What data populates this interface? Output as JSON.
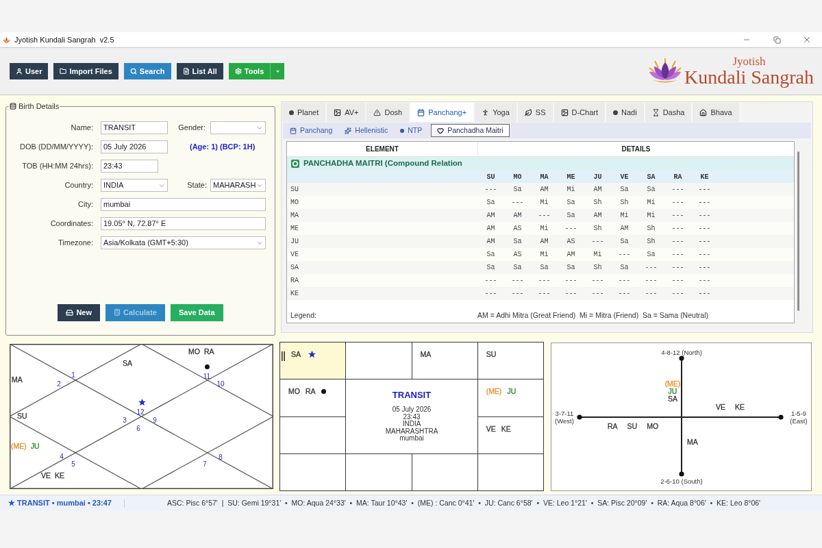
{
  "window": {
    "title": "Jyotish Kundali Sangrah  v2.5"
  },
  "toolbar": {
    "buttons": [
      {
        "label": "User",
        "kind": "dark"
      },
      {
        "label": "Import Files",
        "kind": "dark"
      },
      {
        "label": "Search",
        "kind": "blue"
      },
      {
        "label": "List All",
        "kind": "dark"
      },
      {
        "label": "Tools",
        "kind": "split"
      }
    ]
  },
  "logo": {
    "title": "Jyotish",
    "subtitle": "Kundali Sangrah"
  },
  "birth_details": {
    "title": "Birth Details",
    "name": {
      "label": "Name:",
      "value": "TRANSIT"
    },
    "gender": {
      "label": "Gender:"
    },
    "dob": {
      "label": "DOB (DD/MM/YYYY):",
      "value": "05 July 2026"
    },
    "age_note": "(Age: 1) (BCP: 1H)",
    "tob": {
      "label": "TOB (HH:MM 24hrs):",
      "value": "23:43"
    },
    "country": {
      "label": "Country:",
      "value": "INDIA"
    },
    "state": {
      "label": "State:",
      "value": "MAHARASH"
    },
    "city": {
      "label": "City:",
      "value": "mumbai"
    },
    "coordinates": {
      "label": "Coordinates:",
      "value": "19.05° N, 72.87° E"
    },
    "timezone": {
      "label": "Timezone:",
      "value": "Asia/Kolkata (GMT+5:30)"
    },
    "buttons": [
      {
        "label": "New",
        "kind": "dark",
        "disabled": false
      },
      {
        "label": "Calculate",
        "kind": "blue",
        "disabled": true
      },
      {
        "label": "Save Data",
        "kind": "green",
        "disabled": false
      }
    ]
  },
  "tabs": [
    {
      "label": "Planet",
      "selected": false
    },
    {
      "label": "AV+",
      "selected": false
    },
    {
      "label": "Dosh",
      "selected": false
    },
    {
      "label": "Panchang+",
      "selected": true
    },
    {
      "label": "Yoga",
      "selected": false
    },
    {
      "label": "SS",
      "selected": false
    },
    {
      "label": "D-Chart",
      "selected": false
    },
    {
      "label": "Nadi",
      "selected": false
    },
    {
      "label": "Dasha",
      "selected": false
    },
    {
      "label": "Bhava",
      "selected": false
    }
  ],
  "sub_tabs": [
    {
      "label": "Panchang",
      "selected": false
    },
    {
      "label": "Hellenistic",
      "selected": false
    },
    {
      "label": "NTP",
      "selected": false
    },
    {
      "label": "Panchadha Maitri",
      "selected": true
    }
  ],
  "maitri_table": {
    "headers": {
      "element": "ELEMENT",
      "details": "DETAILS"
    },
    "section": "PANCHADHA MAITRI (Compound Relation",
    "planet_columns": [
      "SU",
      "MO",
      "MA",
      "ME",
      "JU",
      "VE",
      "SA",
      "RA",
      "KE"
    ],
    "rows": [
      {
        "label": "SU",
        "cells": [
          "---",
          "Sa",
          "AM",
          "Mi",
          "AM",
          "Sa",
          "Sa",
          "---",
          "---"
        ]
      },
      {
        "label": "MO",
        "cells": [
          "Sa",
          "---",
          "Mi",
          "Sa",
          "Sh",
          "Sh",
          "Mi",
          "---",
          "---"
        ]
      },
      {
        "label": "MA",
        "cells": [
          "AM",
          "AM",
          "---",
          "Sa",
          "AM",
          "Mi",
          "Mi",
          "---",
          "---"
        ]
      },
      {
        "label": "ME",
        "cells": [
          "AM",
          "AS",
          "Mi",
          "---",
          "Sh",
          "AM",
          "Sh",
          "---",
          "---"
        ]
      },
      {
        "label": "JU",
        "cells": [
          "AM",
          "Sa",
          "AM",
          "AS",
          "---",
          "Sa",
          "Sh",
          "---",
          "---"
        ]
      },
      {
        "label": "VE",
        "cells": [
          "Sa",
          "AS",
          "Mi",
          "AM",
          "Mi",
          "---",
          "Sa",
          "---",
          "---"
        ]
      },
      {
        "label": "SA",
        "cells": [
          "Sa",
          "Sa",
          "Sa",
          "Sa",
          "Sh",
          "Sa",
          "---",
          "---",
          "---"
        ]
      },
      {
        "label": "RA",
        "cells": [
          "---",
          "---",
          "---",
          "---",
          "---",
          "---",
          "---",
          "---",
          "---"
        ]
      },
      {
        "label": "KE",
        "cells": [
          "---",
          "---",
          "---",
          "---",
          "---",
          "---",
          "---",
          "---",
          "---"
        ]
      }
    ],
    "legend_label": "Legend:",
    "legend": "AM = Adhi Mitra (Great Friend)  Mi = Mitra (Friend)  Sa = Sama (Neutral)"
  },
  "north_chart": {
    "houses": [
      {
        "sign": "12",
        "planets": [
          {
            "name": "SA",
            "color": "#3a3a3a"
          }
        ],
        "star_mark": true,
        "dot_mark": false
      },
      {
        "sign": "1",
        "star_mark": false,
        "dot_mark": false
      },
      {
        "sign": "2",
        "planets": [
          {
            "name": "MA",
            "color": "#3a3a3a"
          }
        ],
        "star_mark": false,
        "dot_mark": false
      },
      {
        "sign": "3",
        "planets": [
          {
            "name": "SU",
            "color": "#3a3a3a"
          }
        ],
        "star_mark": false,
        "dot_mark": false
      },
      {
        "sign": "4",
        "planets": [
          {
            "name": "(ME)",
            "color": "#e8912d"
          },
          {
            "name": "JU",
            "color": "#2e8b2e"
          }
        ],
        "star_mark": false,
        "dot_mark": false
      },
      {
        "sign": "5",
        "planets": [
          {
            "name": "VE",
            "color": "#3a3a3a"
          },
          {
            "name": "KE",
            "color": "#3a3a3a"
          }
        ],
        "star_mark": false,
        "dot_mark": false
      },
      {
        "sign": "6",
        "star_mark": false,
        "dot_mark": false
      },
      {
        "sign": "7",
        "star_mark": false,
        "dot_mark": false
      },
      {
        "sign": "8",
        "star_mark": false,
        "dot_mark": false
      },
      {
        "sign": "9",
        "star_mark": false,
        "dot_mark": false
      },
      {
        "sign": "10",
        "star_mark": false,
        "dot_mark": false
      },
      {
        "sign": "11",
        "planets": [
          {
            "name": "MO",
            "color": "#3a3a3a"
          },
          {
            "name": "RA",
            "color": "#3a3a3a"
          }
        ],
        "star_mark": false,
        "dot_mark": true
      }
    ]
  },
  "south_chart": {
    "cells": [
      {
        "highlighted": true,
        "planets": [
          {
            "name": "SA",
            "color": "#3a3a3a"
          }
        ],
        "star_mark": true,
        "dot_mark": false
      },
      {
        "highlighted": false,
        "star_mark": false,
        "dot_mark": false
      },
      {
        "highlighted": false,
        "planets": [
          {
            "name": "MA",
            "color": "#3a3a3a"
          }
        ],
        "star_mark": false,
        "dot_mark": false
      },
      {
        "highlighted": false,
        "planets": [
          {
            "name": "SU",
            "color": "#3a3a3a"
          }
        ],
        "star_mark": false,
        "dot_mark": false
      },
      {
        "highlighted": false,
        "planets": [
          {
            "name": "MO",
            "color": "#3a3a3a"
          },
          {
            "name": "RA",
            "color": "#3a3a3a"
          }
        ],
        "star_mark": false,
        "dot_mark": true
      },
      {
        "highlighted": false,
        "planets": [
          {
            "name": "(ME)",
            "color": "#e8912d"
          },
          {
            "name": "JU",
            "color": "#2e8b2e"
          }
        ],
        "star_mark": false,
        "dot_mark": false
      },
      {
        "highlighted": false,
        "star_mark": false,
        "dot_mark": false
      },
      {
        "highlighted": false,
        "planets": [
          {
            "name": "VE",
            "color": "#3a3a3a"
          },
          {
            "name": "KE",
            "color": "#3a3a3a"
          }
        ],
        "star_mark": false,
        "dot_mark": false
      },
      {
        "highlighted": false,
        "star_mark": false,
        "dot_mark": false
      },
      {
        "highlighted": false,
        "star_mark": false,
        "dot_mark": false
      },
      {
        "highlighted": false,
        "star_mark": false,
        "dot_mark": false
      },
      {
        "highlighted": false,
        "star_mark": false,
        "dot_mark": false
      }
    ],
    "center": {
      "title": "TRANSIT",
      "lines": [
        "05 July 2026",
        "23:43",
        "INDIA",
        "MAHARASHTRA",
        "mumbai"
      ]
    }
  },
  "cross_chart": {
    "quadrants": [
      {
        "kind": "north",
        "label": "4-8-12 (North)",
        "planets": [
          {
            "name": "(ME)",
            "color": "#e8912d"
          },
          {
            "name": "JU",
            "color": "#2e8b2e"
          },
          {
            "name": "SA",
            "color": "#3a3a3a"
          }
        ]
      },
      {
        "kind": "west",
        "label": "3-7-11 (West)",
        "planets": [
          {
            "name": "RA",
            "color": "#3a3a3a"
          },
          {
            "name": "SU",
            "color": "#3a3a3a"
          },
          {
            "name": "MO",
            "color": "#3a3a3a"
          }
        ]
      },
      {
        "kind": "east",
        "label": "1-5-9 (East)",
        "planets": [
          {
            "name": "VE",
            "color": "#3a3a3a"
          },
          {
            "name": "KE",
            "color": "#3a3a3a"
          }
        ]
      },
      {
        "kind": "south",
        "label": "2-6-10 (South)",
        "planets": [
          {
            "name": "MA",
            "color": "#3a3a3a"
          }
        ]
      }
    ]
  },
  "status_bar": {
    "summary": "★ TRANSIT • mumbai • 23:47",
    "positions": "ASC: Pisc 6°57'  |  SU: Gemi 19°31'  •  MO: Aqua 24°33'  •  MA: Taur 10°43'  •  (ME) : Canc 0°41'  •  JU: Canc 6°58'  •  VE: Leo 1°21'  •  SA: Pisc 20°09'  •  RA: Aqua 8°06'  •  KE: Leo 8°06'"
  }
}
